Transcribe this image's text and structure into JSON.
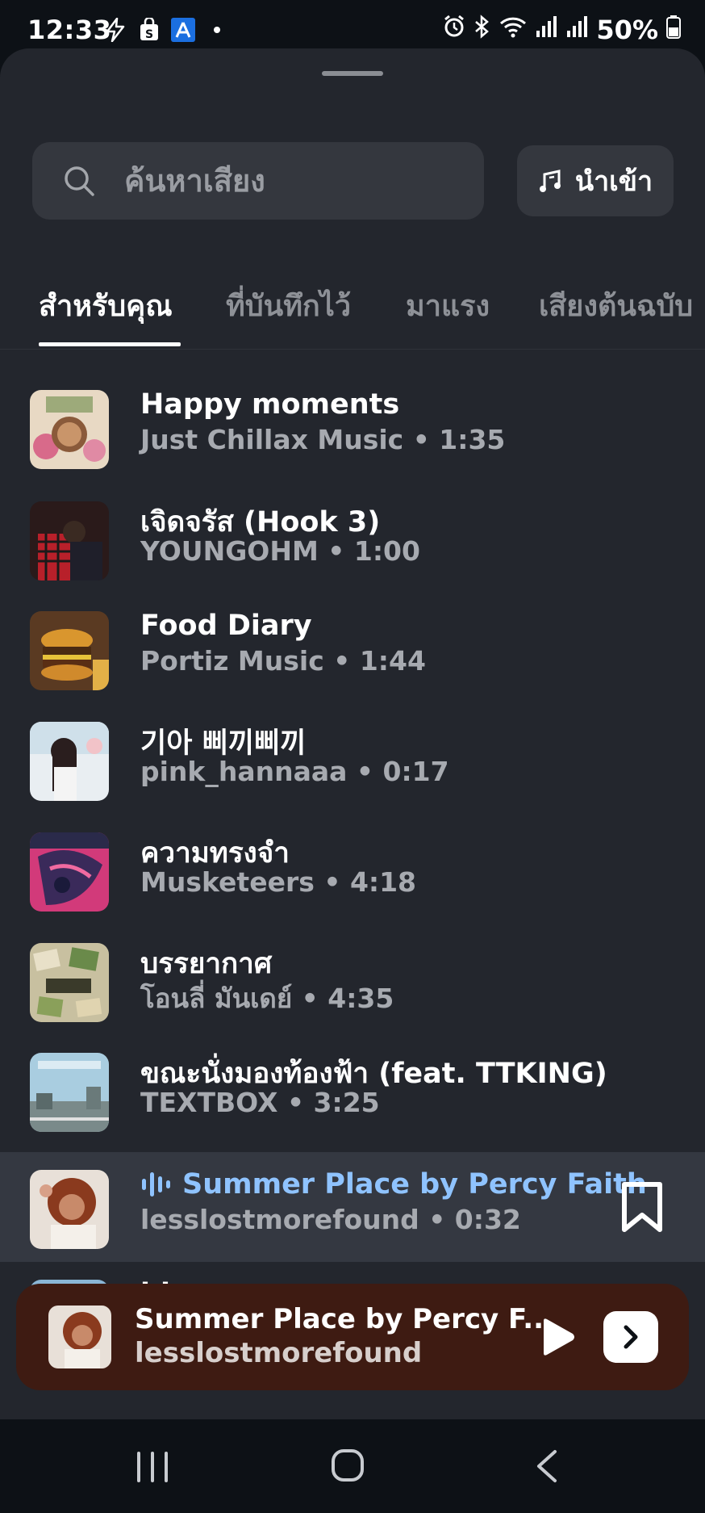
{
  "status_bar": {
    "time": "12:33",
    "battery": "50%"
  },
  "search": {
    "placeholder": "ค้นหาเสียง"
  },
  "import_button": {
    "label": "นำเข้า"
  },
  "tabs": [
    {
      "label": "สำหรับคุณ",
      "active": true
    },
    {
      "label": "ที่บันทึกไว้",
      "active": false
    },
    {
      "label": "มาแรง",
      "active": false
    },
    {
      "label": "เสียงต้นฉบับ",
      "active": false
    }
  ],
  "tracks": [
    {
      "title": "Happy moments",
      "subtitle": "Just Chillax Music • 1:35"
    },
    {
      "title": "เจิดจรัส (Hook 3)",
      "subtitle": "YOUNGOHM • 1:00"
    },
    {
      "title": "Food Diary",
      "subtitle": "Portiz Music • 1:44"
    },
    {
      "title": "기아 삐끼삐끼",
      "subtitle": "pink_hannaaa • 0:17"
    },
    {
      "title": "ความทรงจำ",
      "subtitle": "Musketeers • 4:18"
    },
    {
      "title": "บรรยากาศ",
      "subtitle": "โอนลี่ มันเดย์ • 4:35"
    },
    {
      "title": "ขณะนั่งมองท้องฟ้า (feat. TTKING)",
      "subtitle": "TEXTBOX • 3:25"
    },
    {
      "title": "Summer Place by Percy Faith",
      "subtitle": "lesslostmorefound • 0:32"
    },
    {
      "title": "blue",
      "subtitle": ""
    }
  ],
  "now_playing": {
    "title": "Summer Place by Percy F..",
    "artist": "lesslostmorefound"
  },
  "colors": {
    "sheet": "#23262d",
    "highlight_row": "#343841",
    "playing_accent": "#8fc3ff",
    "player_bg": "#3e1b12"
  }
}
